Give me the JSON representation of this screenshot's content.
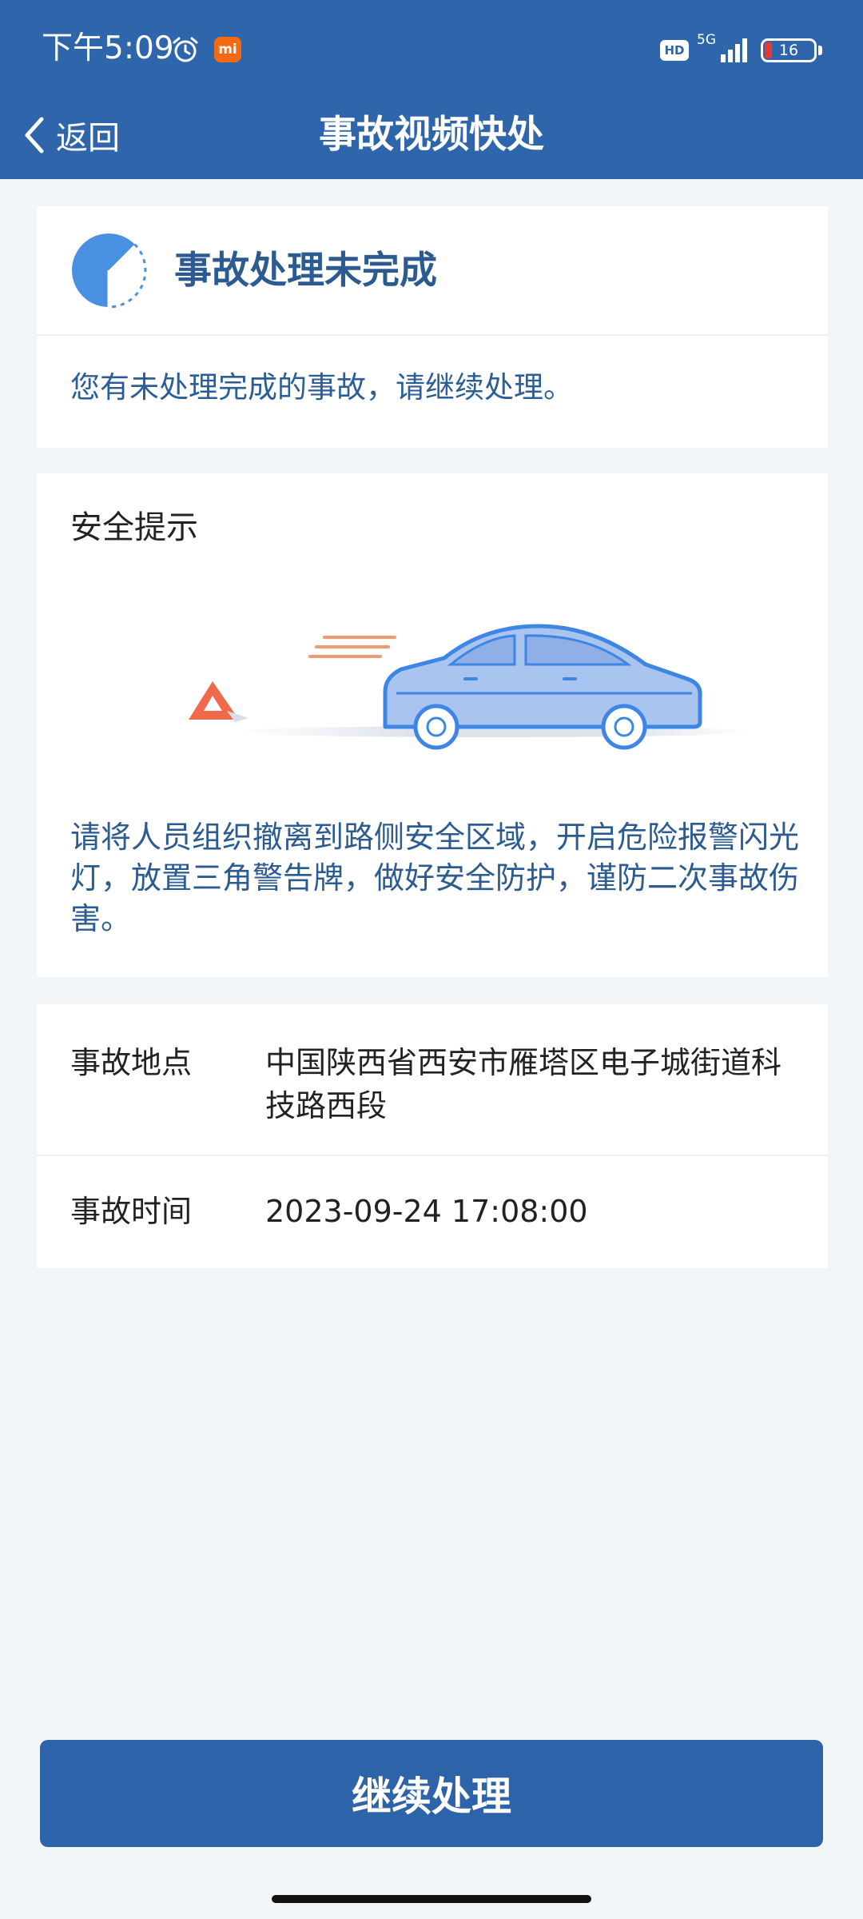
{
  "status_bar": {
    "time": "下午5:09",
    "mi_badge": "mi",
    "hd_label": "HD",
    "network_label": "5G",
    "battery_level": "16"
  },
  "nav": {
    "back_label": "返回",
    "title": "事故视频快处"
  },
  "status_card": {
    "title": "事故处理未完成",
    "message": "您有未处理完成的事故，请继续处理。",
    "icon": "pending-progress-icon"
  },
  "safety_card": {
    "title": "安全提示",
    "illustration": "car-with-warning-triangle",
    "text": "请将人员组织撤离到路侧安全区域，开启危险报警闪光灯，放置三角警告牌，做好安全防护，谨防二次事故伤害。"
  },
  "accident_info": {
    "location_label": "事故地点",
    "location_value": "中国陕西省西安市雁塔区电子城街道科技路西段",
    "time_label": "事故时间",
    "time_value": "2023-09-24 17:08:00"
  },
  "actions": {
    "continue_label": "继续处理"
  },
  "colors": {
    "header_bg": "#2f65ab",
    "accent_text": "#2c5b92",
    "page_bg": "#f2f6f9",
    "button_bg": "#2d63a8",
    "battery_low": "#e53935",
    "mi_orange": "#f36a12"
  }
}
